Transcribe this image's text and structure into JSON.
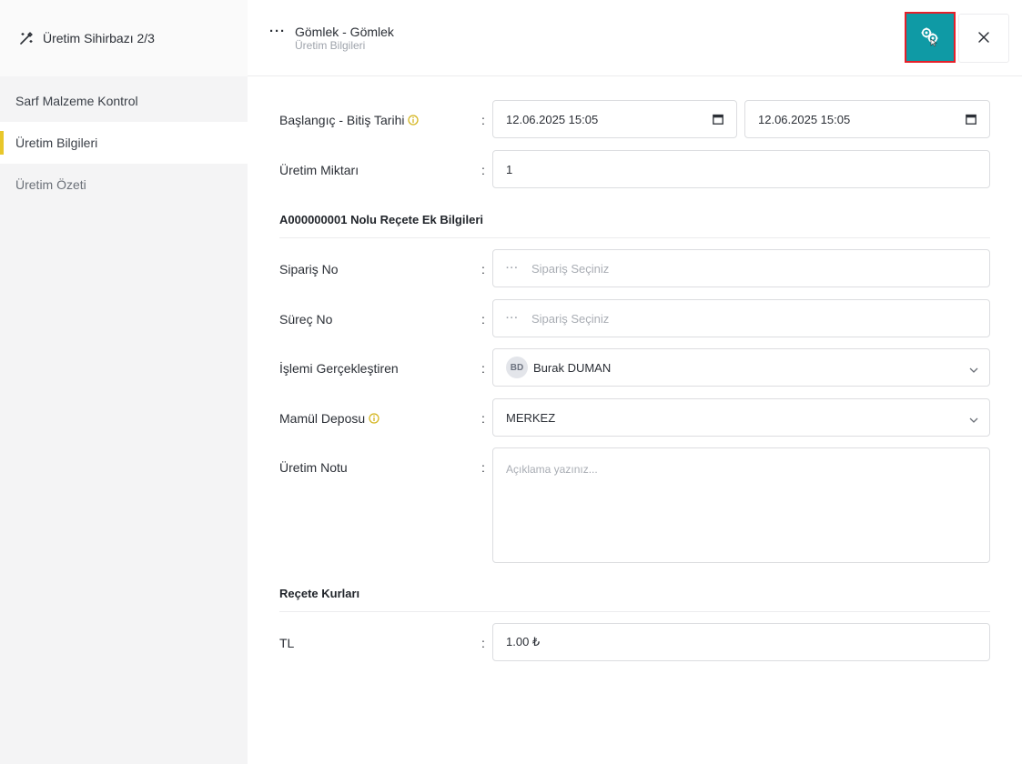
{
  "sidebar": {
    "wizard_title": "Üretim Sihirbazı 2/3",
    "items": [
      {
        "label": "Sarf Malzeme Kontrol"
      },
      {
        "label": "Üretim Bilgileri"
      },
      {
        "label": "Üretim Özeti"
      }
    ]
  },
  "header": {
    "title": "Gömlek - Gömlek",
    "subtitle": "Üretim Bilgileri",
    "action_icon": "gears-icon",
    "close_icon": "close-icon"
  },
  "form": {
    "dates": {
      "label": "Başlangıç - Bitiş Tarihi",
      "start": "12.06.2025 15:05",
      "end": "12.06.2025 15:05"
    },
    "quantity": {
      "label": "Üretim Miktarı",
      "value": "1"
    },
    "recipe_section": "A000000001 Nolu Reçete Ek Bilgileri",
    "order_no": {
      "label": "Sipariş No",
      "placeholder": "Sipariş Seçiniz"
    },
    "process_no": {
      "label": "Süreç No",
      "placeholder": "Sipariş Seçiniz"
    },
    "performer": {
      "label": "İşlemi Gerçekleştiren",
      "initials": "BD",
      "value": "Burak DUMAN"
    },
    "warehouse": {
      "label": "Mamül Deposu",
      "value": "MERKEZ"
    },
    "note": {
      "label": "Üretim Notu",
      "placeholder": "Açıklama yazınız..."
    },
    "rates_section": "Reçete Kurları",
    "currency": {
      "label": "TL",
      "value": "1.00 ₺"
    }
  },
  "colon": ":",
  "colors": {
    "accent": "#0f9aa5",
    "active_marker": "#e8c72a",
    "highlight_border": "#e5202a"
  }
}
